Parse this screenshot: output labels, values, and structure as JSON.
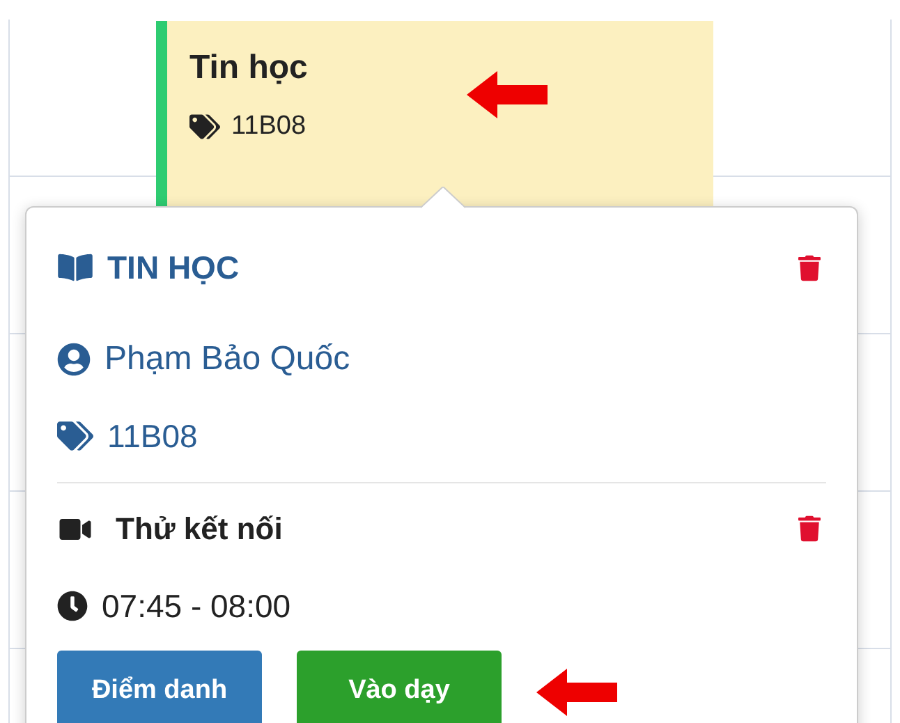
{
  "event": {
    "title": "Tin học",
    "room": "11B08"
  },
  "popover": {
    "subject": "TIN HỌC",
    "teacher": "Phạm Bảo Quốc",
    "room": "11B08",
    "session": {
      "title": "Thử kết nối",
      "time": "07:45 - 08:00"
    },
    "buttons": [
      {
        "label": "Điểm danh",
        "color": "#337ab7"
      },
      {
        "label": "Vào dạy",
        "color": "#2ca02c"
      }
    ]
  }
}
